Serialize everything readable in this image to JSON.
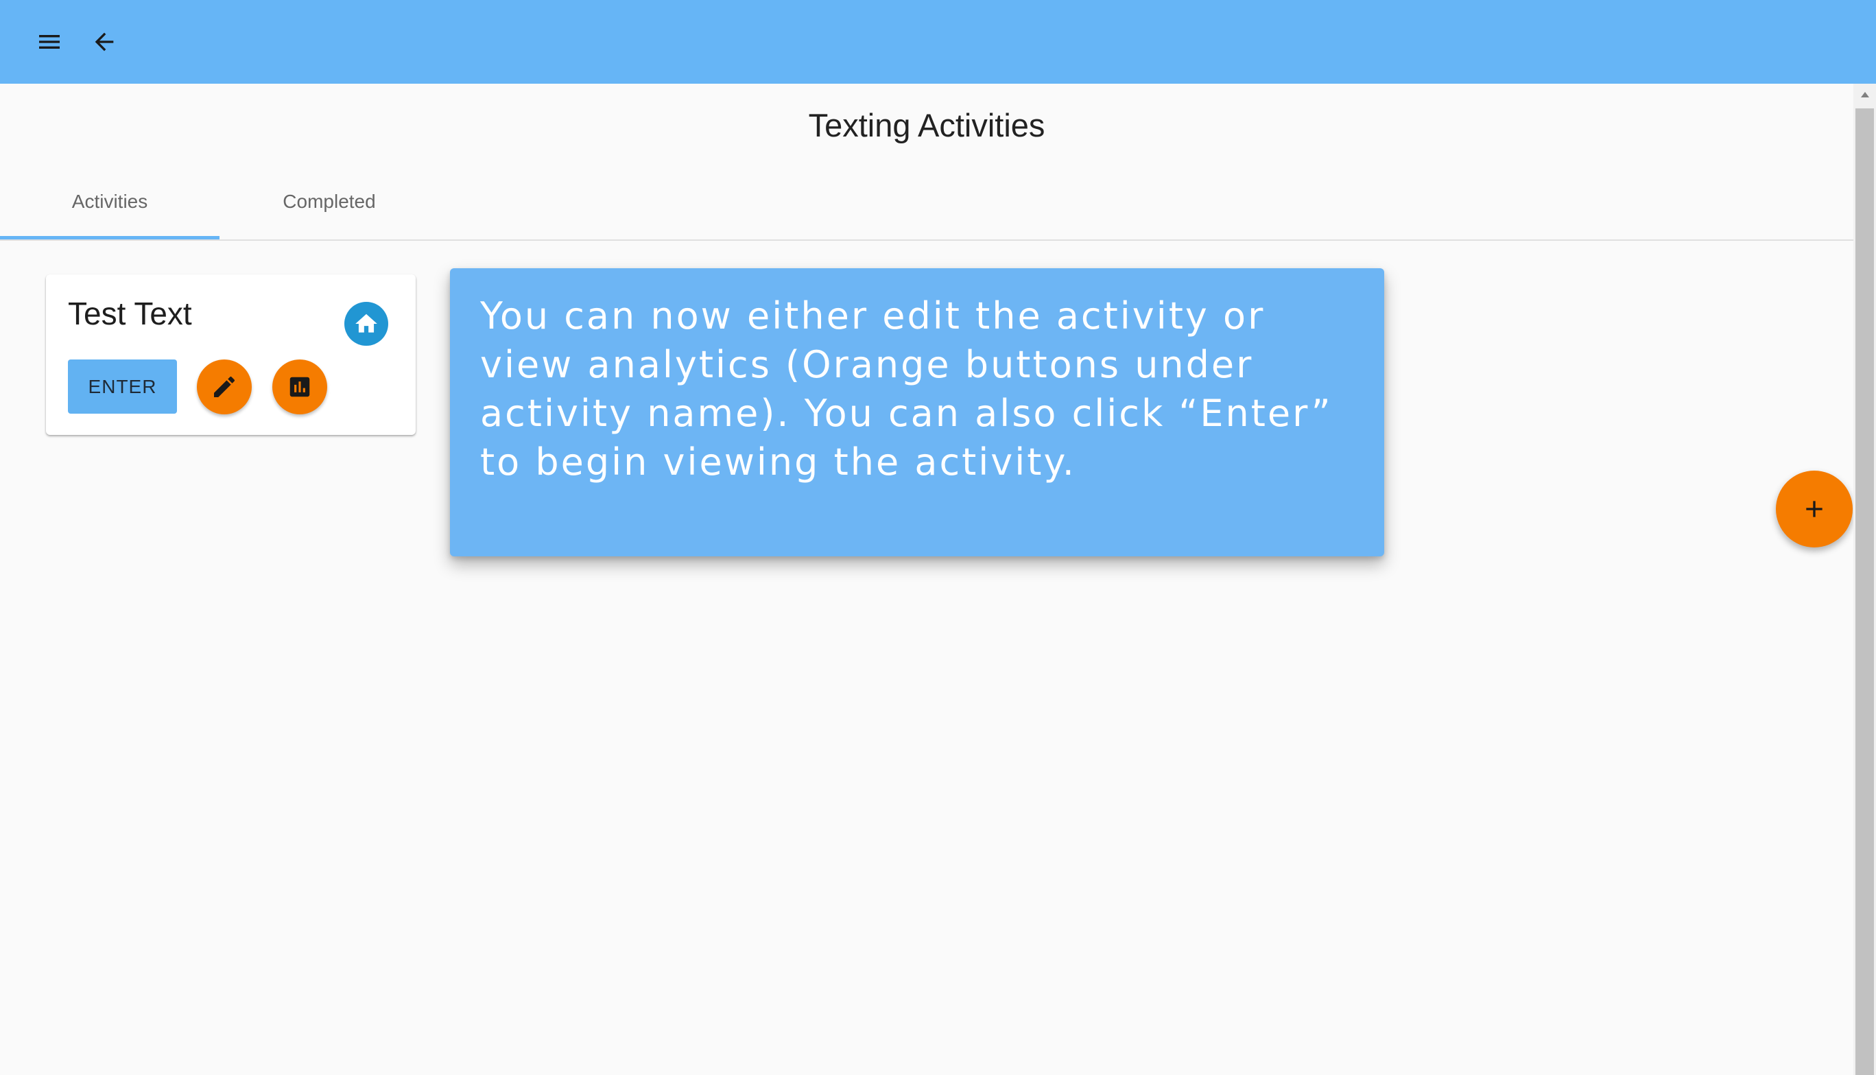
{
  "header": {
    "menu_icon": "menu-icon",
    "back_icon": "arrow-back-icon",
    "color": "#66b5f6"
  },
  "page": {
    "title": "Texting Activities"
  },
  "tabs": [
    {
      "label": "Activities",
      "selected": true
    },
    {
      "label": "Completed",
      "selected": false
    }
  ],
  "activity_card": {
    "title": "Test Text",
    "enter_label": "ENTER",
    "home_icon": "home-icon",
    "edit_icon": "pencil-icon",
    "analytics_icon": "bar-chart-icon"
  },
  "tooltip": {
    "text": "You can now either edit the activity or view analytics (Orange buttons under activity name). You can also click “Enter” to begin viewing the activity."
  },
  "fab": {
    "icon": "plus-icon",
    "color": "#f57c00"
  }
}
